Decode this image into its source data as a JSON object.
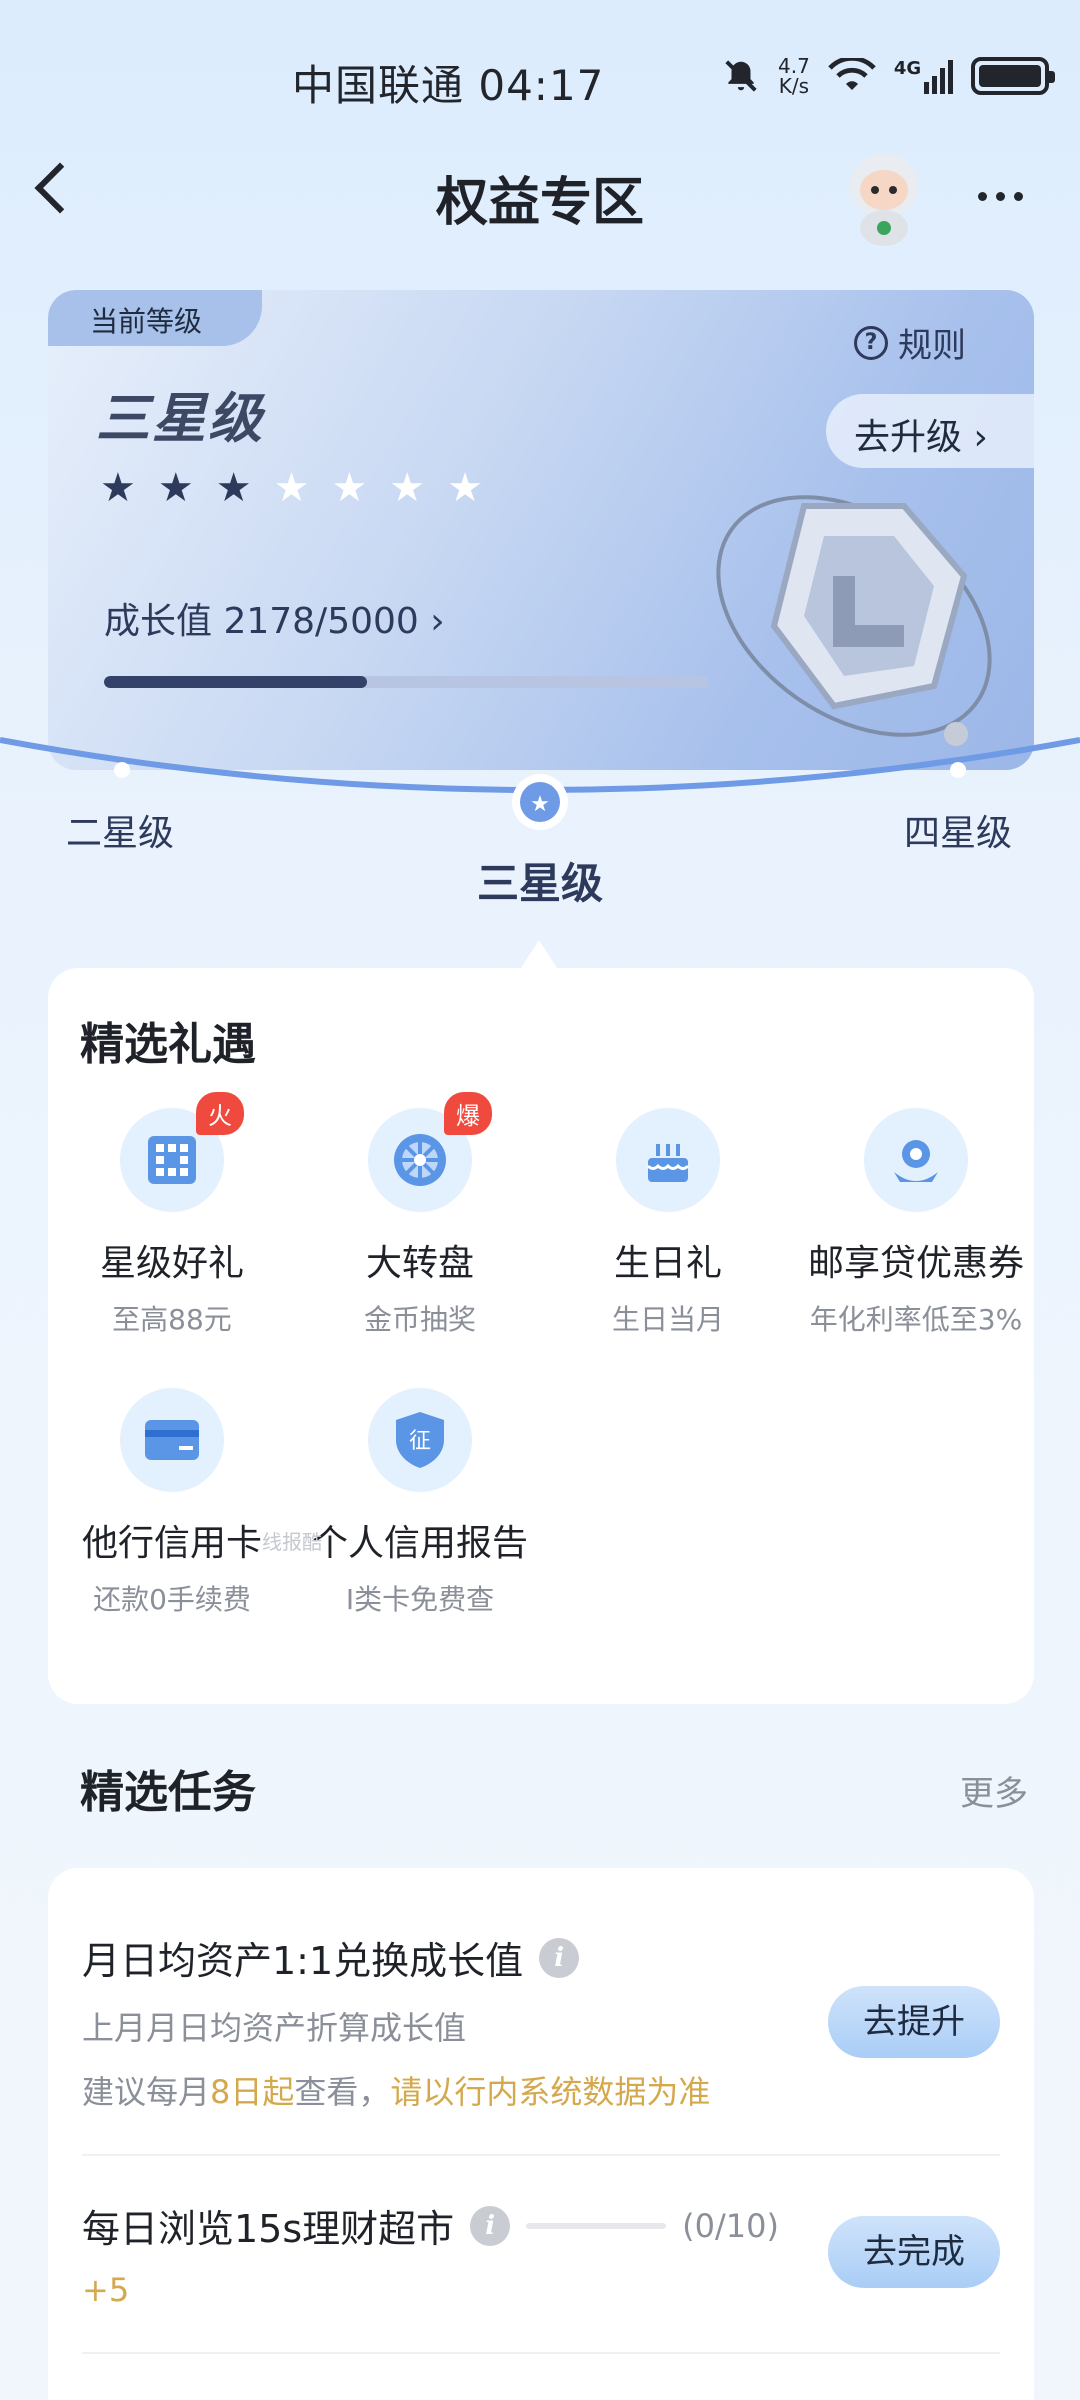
{
  "status_bar": {
    "carrier_time": "中国联通 04:17",
    "speed_value": "4.7",
    "speed_unit": "K/s",
    "network": "4G"
  },
  "header": {
    "title": "权益专区"
  },
  "level_card": {
    "tag": "当前等级",
    "level_name": "三星级",
    "stars_on": 3,
    "stars_total": 7,
    "rules_label": "规则",
    "upgrade_label": "去升级 ›",
    "growth_label": "成长值 2178/5000 ›",
    "growth_progress": 0.4356
  },
  "level_arc": {
    "prev": "二星级",
    "current": "三星级",
    "next": "四星级"
  },
  "gifts": {
    "title": "精选礼遇",
    "items": [
      {
        "title": "星级好礼",
        "sub": "至高88元",
        "badge": "火",
        "icon": "building-icon"
      },
      {
        "title": "大转盘",
        "sub": "金币抽奖",
        "badge": "爆",
        "icon": "wheel-icon"
      },
      {
        "title": "生日礼",
        "sub": "生日当月",
        "badge": "",
        "icon": "cake-icon"
      },
      {
        "title": "邮享贷优惠券",
        "sub": "年化利率低至3%",
        "badge": "",
        "icon": "loan-icon"
      },
      {
        "title": "他行信用卡",
        "sub": "还款0手续费",
        "badge": "",
        "icon": "card-icon"
      },
      {
        "title": "个人信用报告",
        "sub": "I类卡免费查",
        "badge": "",
        "icon": "shield-zheng-icon"
      }
    ],
    "watermark": "线报酷"
  },
  "tasks": {
    "title": "精选任务",
    "more": "更多",
    "items": [
      {
        "title": "月日均资产1:1兑换成长值",
        "sub": "上月月日均资产折算成长值",
        "note_prefix": "建议每月",
        "note_highlight1": "8日起",
        "note_mid": "查看，",
        "note_highlight2": "请以行内系统数据为准",
        "button": "去提升"
      },
      {
        "title": "每日浏览15s理财超市",
        "progress": "(0/10)",
        "reward": "+5",
        "button": "去完成"
      }
    ]
  },
  "colors": {
    "accent": "#2d3a5c",
    "badge_red": "#f04a3e",
    "highlight_gold": "#d4a94e",
    "button_blue": "#a9cdf6"
  }
}
